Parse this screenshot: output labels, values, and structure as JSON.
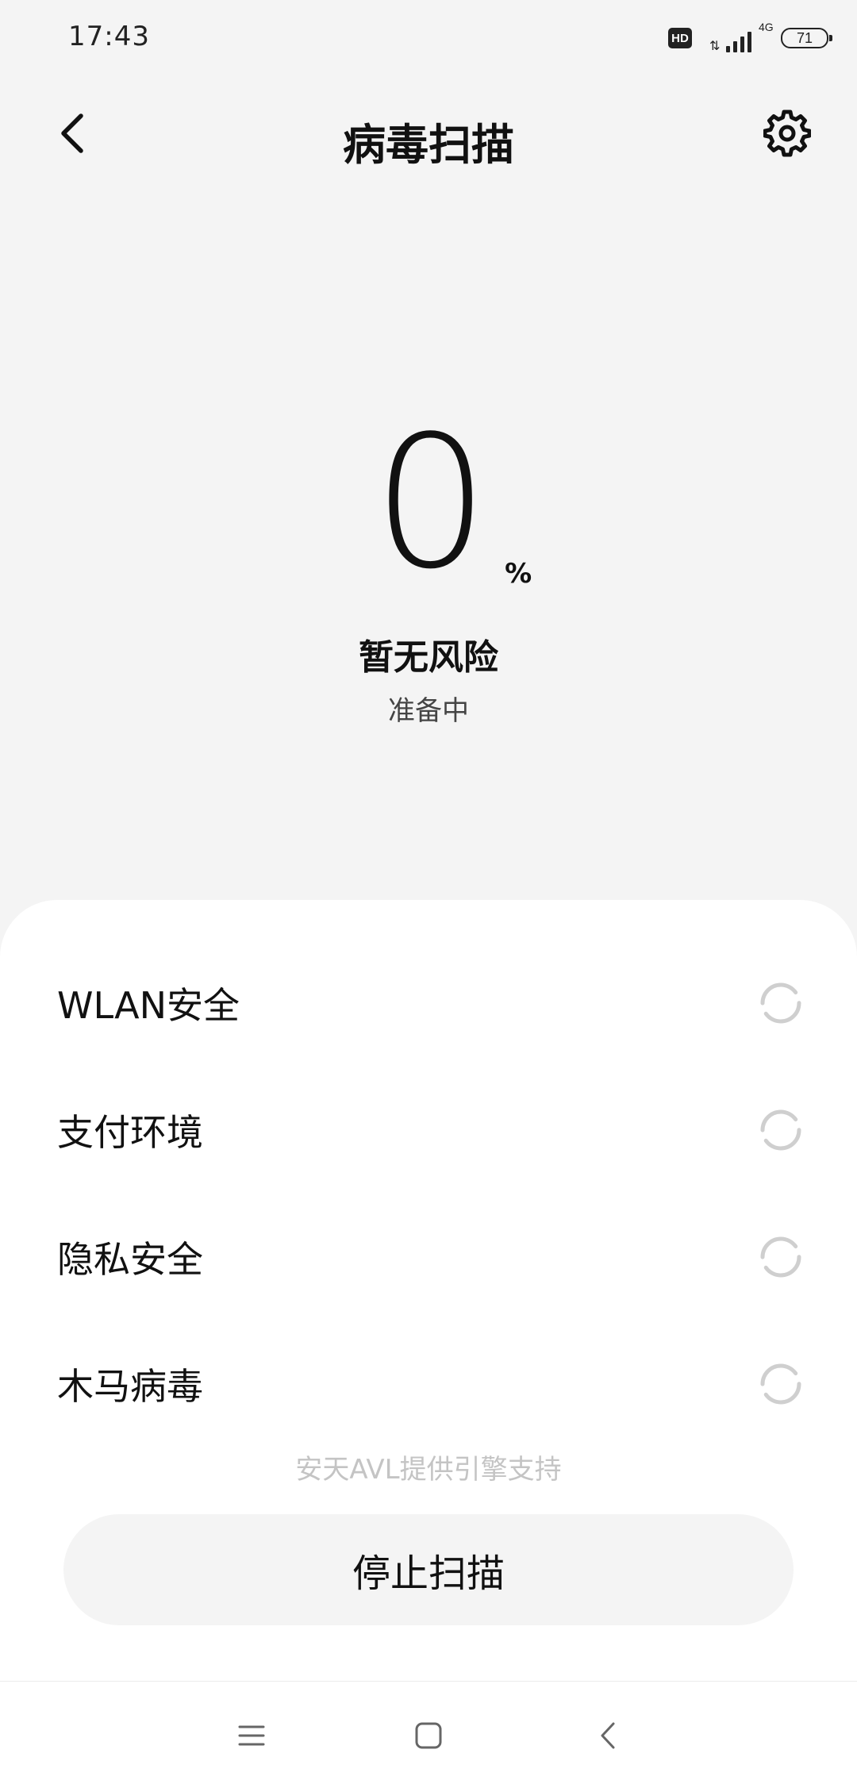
{
  "status_bar": {
    "time": "17:43",
    "hd_badge": "HD",
    "network_type": "4G",
    "battery_level": "71"
  },
  "header": {
    "title": "病毒扫描",
    "back_icon": "back-arrow-icon",
    "settings_icon": "gear-icon"
  },
  "progress": {
    "value": "0",
    "unit": "%",
    "risk_status": "暂无风险",
    "phase": "准备中"
  },
  "scan_items": [
    {
      "label": "WLAN安全",
      "status_icon": "loading-spinner-icon"
    },
    {
      "label": "支付环境",
      "status_icon": "loading-spinner-icon"
    },
    {
      "label": "隐私安全",
      "status_icon": "loading-spinner-icon"
    },
    {
      "label": "木马病毒",
      "status_icon": "loading-spinner-icon"
    }
  ],
  "footer": {
    "engine_note": "安天AVL提供引擎支持",
    "stop_label": "停止扫描"
  },
  "nav_bar": {
    "menu_icon": "menu-icon",
    "home_icon": "home-square-icon",
    "back_icon": "back-chevron-icon"
  },
  "colors": {
    "background": "#f4f4f4",
    "sheet": "#ffffff",
    "text": "#111111",
    "muted": "#c4c4c4",
    "spinner": "#cfcfcf"
  }
}
